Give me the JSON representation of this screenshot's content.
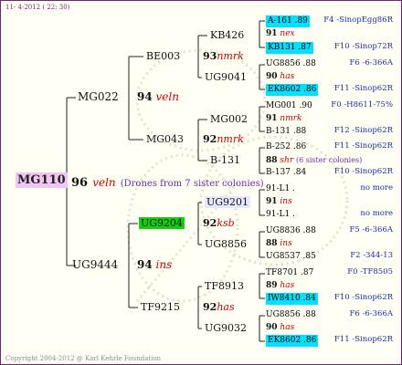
{
  "header": "11- 4-2012 ( 22: 30)",
  "copyright": "Copyright 2004-2012 @ Karl Kehrle Foundation",
  "root": {
    "id": "MG110",
    "num": "96",
    "code": "veln",
    "note": "(Drones from 7 sister colonies)"
  },
  "gen1": [
    {
      "id": "MG022",
      "num": "94",
      "code": "veln"
    },
    {
      "id": "UG9444",
      "num": "94",
      "code": "ins"
    }
  ],
  "gen2": [
    {
      "id": "BE003",
      "num": "93",
      "code": "nmrk"
    },
    {
      "id": "MG043",
      "num": "92",
      "code": "nmrk"
    },
    {
      "id": "UG9204",
      "num": "92",
      "code": "ksb"
    },
    {
      "id": "TF9215",
      "num": "92",
      "code": "has"
    }
  ],
  "gen3": [
    {
      "id": "KB426"
    },
    {
      "id": "UG9041"
    },
    {
      "id": "MG002"
    },
    {
      "id": "B-131"
    },
    {
      "id": "UG9201"
    },
    {
      "id": "UG8856"
    },
    {
      "id": "TF8913"
    },
    {
      "id": "UG9032"
    }
  ],
  "gen4": [
    {
      "left": "A-161 .89",
      "right": "F4 -SinopEgg86R"
    },
    {
      "num": "91",
      "code": "nex"
    },
    {
      "left": "KB131 .87",
      "right": "F10 -Sinop72R"
    },
    {
      "left": "UG8856 .88",
      "right": "F6 -6-366A"
    },
    {
      "num": "90",
      "code": "has"
    },
    {
      "left": "EK8602 .86",
      "right": "F11 -Sinop62R"
    },
    {
      "left": "MG001 .90",
      "right": "F0 -H8611-75%"
    },
    {
      "num": "91",
      "code": "nmrk"
    },
    {
      "left": "B-131 .88",
      "right": "F12 -Sinop62R"
    },
    {
      "left": "B-252 .86",
      "right": "F11 -Sinop62R"
    },
    {
      "num": "88",
      "code": "shr",
      "note": "(6 sister colonies)"
    },
    {
      "left": "B-137 .84",
      "right": "F10 -Sinop62R"
    },
    {
      "left": "91-L1 .",
      "right": "no more"
    },
    {
      "num": "91",
      "code": "ins"
    },
    {
      "left": "91-L1 .",
      "right": "no more"
    },
    {
      "left": "UG8836 .88",
      "right": "F5 -6-366A"
    },
    {
      "num": "88",
      "code": "ins"
    },
    {
      "left": "UG8537 .85",
      "right": "F2 -344-13"
    },
    {
      "left": "TF8701 .87",
      "right": "F0 -TF8505"
    },
    {
      "num": "89",
      "code": "has"
    },
    {
      "left": "IW8410 .84",
      "right": "F10 -Sinop62R"
    },
    {
      "left": "UG8856 .88",
      "right": "F6 -6-366A"
    },
    {
      "num": "90",
      "code": "has"
    },
    {
      "left": "EK8602 .86",
      "right": "F11 -Sinop62R"
    }
  ]
}
